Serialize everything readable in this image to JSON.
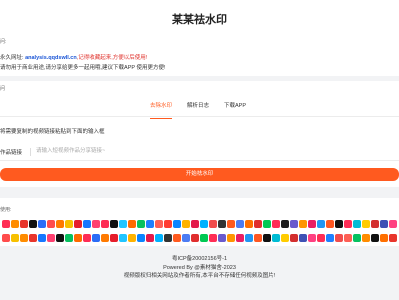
{
  "header": {
    "title": "某某祛水印"
  },
  "notice": {
    "label": "问:",
    "line1_prefix": "永久网址:",
    "url": "analysis.qqdswll.cn",
    "line1_suffix": ",记得收藏起来,方便以后使用!",
    "line2": "请勿用于商业用途,请分享给更多一起用哦,建议下载APP 使用更方便!"
  },
  "tool": {
    "label": "问",
    "tabs": [
      "去除水印",
      "解析日志",
      "下载APP"
    ],
    "active_tab": 0,
    "hint": "将需要复制的视频链接粘贴到下面的输入框",
    "input_label": "作品链接",
    "input_placeholder": "请输入短视频作品分享链接~",
    "submit_label": "开始祛水印"
  },
  "platforms": {
    "label": "使用:",
    "colors": [
      "#ff2d55",
      "#ff8c00",
      "#e8352c",
      "#111111",
      "#2b6cf6",
      "#ff4c4c",
      "#ff7a00",
      "#f7c000",
      "#e61e2b",
      "#1677ff",
      "#ff4070",
      "#fe2c55",
      "#111111",
      "#20c5ff",
      "#ff6a00",
      "#07c160",
      "#1e80ff",
      "#fe5f55",
      "#ff3b30",
      "#0a84ff",
      "#ffb300",
      "#e31a4a",
      "#00b2ff",
      "#f14c4c",
      "#333333",
      "#ff5a1f",
      "#4c7cf3",
      "#ff6f00",
      "#e02e2e",
      "#00c853",
      "#ff2d55",
      "#1b1b1b",
      "#6a5acd",
      "#ff9500",
      "#e91e63",
      "#2196f3",
      "#ff5722",
      "#111111",
      "#fe2c55",
      "#00bcd4",
      "#ffcc00",
      "#d32f2f",
      "#3f51b5",
      "#ff4081"
    ],
    "colors2": [
      "#ff4c4c",
      "#f7c000",
      "#ff8c00",
      "#e8352c",
      "#1677ff",
      "#ff4070",
      "#111111",
      "#07c160",
      "#ff6a00",
      "#fe2c55",
      "#2b6cf6",
      "#ff7a00",
      "#e61e2b",
      "#20c5ff",
      "#ffb300",
      "#0a84ff",
      "#e31a4a",
      "#00b2ff",
      "#333333",
      "#ff5a1f",
      "#4c7cf3",
      "#e02e2e",
      "#00c853",
      "#ff2d55",
      "#6a5acd",
      "#ff9500",
      "#e91e63",
      "#2196f3",
      "#ff5722",
      "#111111",
      "#00bcd4",
      "#ffcc00",
      "#d32f2f",
      "#3f51b5",
      "#ff4081",
      "#ff2d55",
      "#1e80ff",
      "#f14c4c",
      "#fe5f55",
      "#07c160",
      "#ff8c00",
      "#111111",
      "#ff6f00",
      "#e8352c"
    ]
  },
  "footer": {
    "icp": "粤ICP备20002156号-1",
    "powered": "Powered By @素材猫舍-2023",
    "disclaimer": "视频版权归相关网站及作者所有,本平台不存储任何视频及图片!"
  },
  "colors": {
    "accent": "#ff5a1f",
    "link": "#1a55d6",
    "warn": "#e0312b"
  }
}
